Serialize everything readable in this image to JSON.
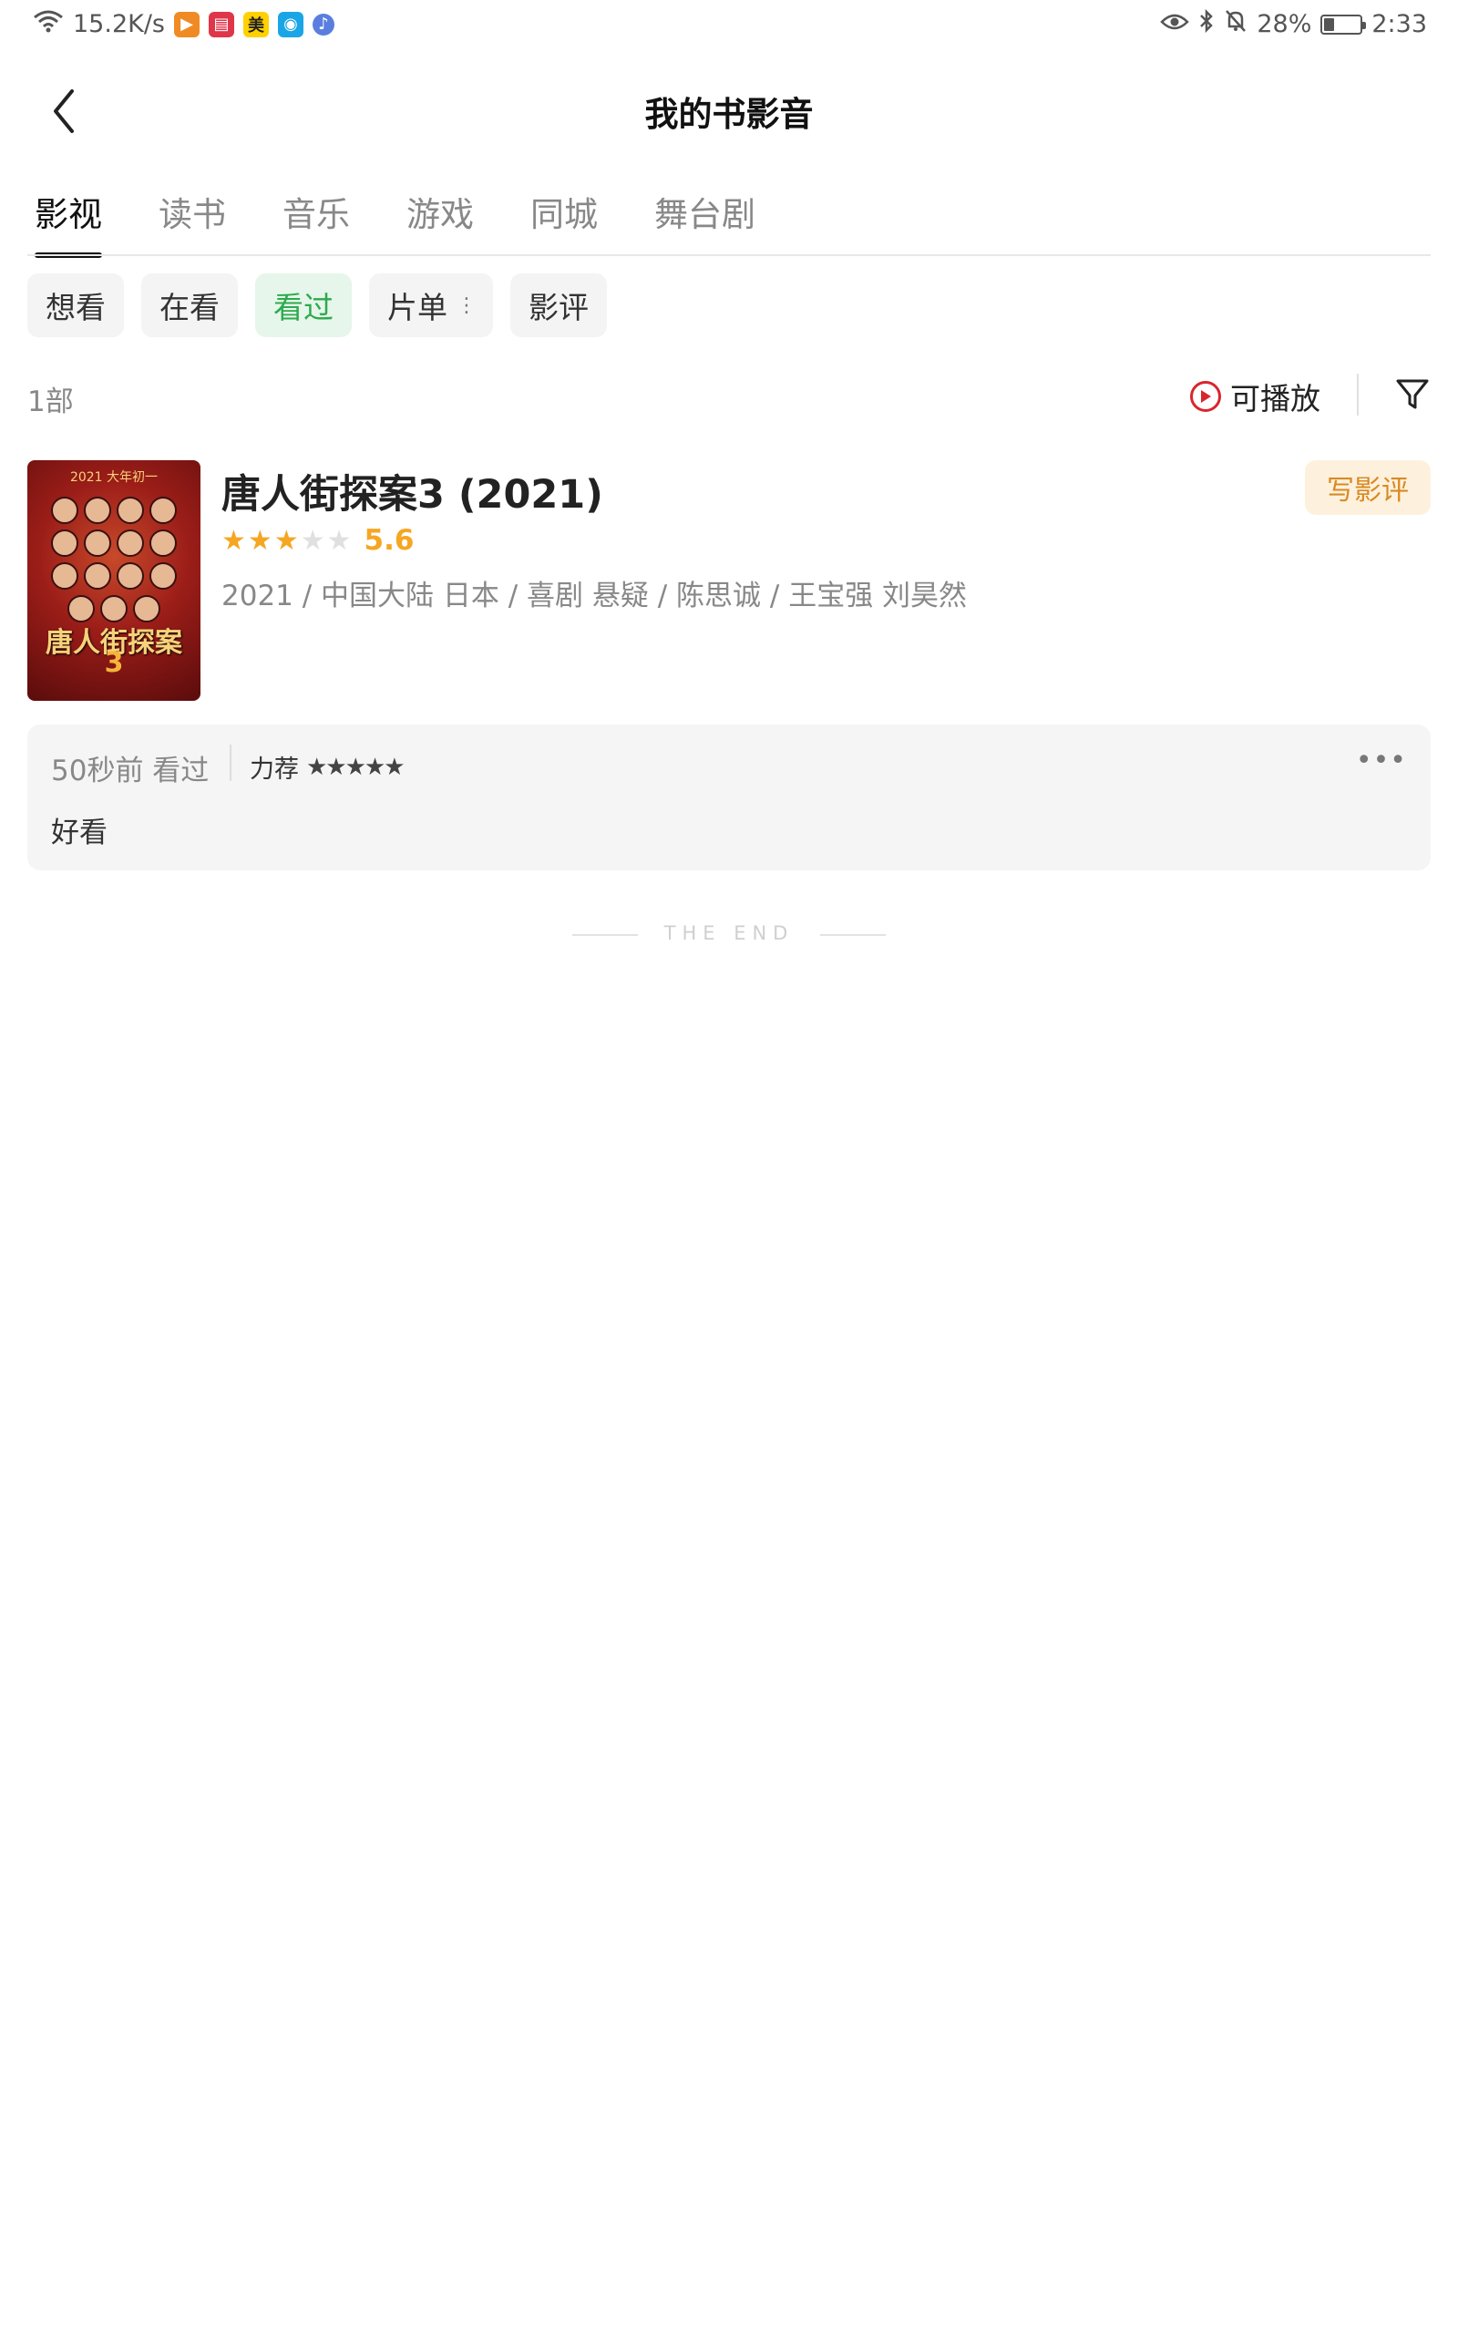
{
  "status_bar": {
    "speed": "15.2K/s",
    "battery": "28%",
    "battery_level": 0.28,
    "time": "2:33",
    "app_icons": [
      "video-app-icon",
      "book-app-icon",
      "meituan-app-icon",
      "bulb-app-icon",
      "music-app-icon"
    ],
    "meituan_label": "美"
  },
  "header": {
    "title": "我的书影音"
  },
  "tabs": [
    "影视",
    "读书",
    "音乐",
    "游戏",
    "同城",
    "舞台剧"
  ],
  "active_tab": "影视",
  "chips": {
    "want": "想看",
    "watching": "在看",
    "watched": "看过",
    "list": "片单",
    "list_more": "⋮",
    "review": "影评"
  },
  "count_label": "1部",
  "playable_label": "可播放",
  "item": {
    "title": "唐人街探案3 (2021)",
    "rating": 3,
    "rating_max": 5,
    "score": "5.6",
    "meta": "2021 / 中国大陆 日本 / 喜剧 悬疑 / 陈思诚 / 王宝强 刘昊然",
    "write_review": "写影评",
    "poster_top": "2021 大年初一",
    "poster_title": "唐人街探案",
    "poster_num": "3"
  },
  "review": {
    "time": "50秒前 看过",
    "recommend_label": "力荐",
    "recommend_stars": "★★★★★",
    "more": "•••",
    "text": "好看"
  },
  "end_label": "THE END",
  "colors": {
    "accent_green": "#2eaa4e",
    "star": "#f5a623",
    "play_red": "#d9262d",
    "review_orange": "#d98a22"
  }
}
